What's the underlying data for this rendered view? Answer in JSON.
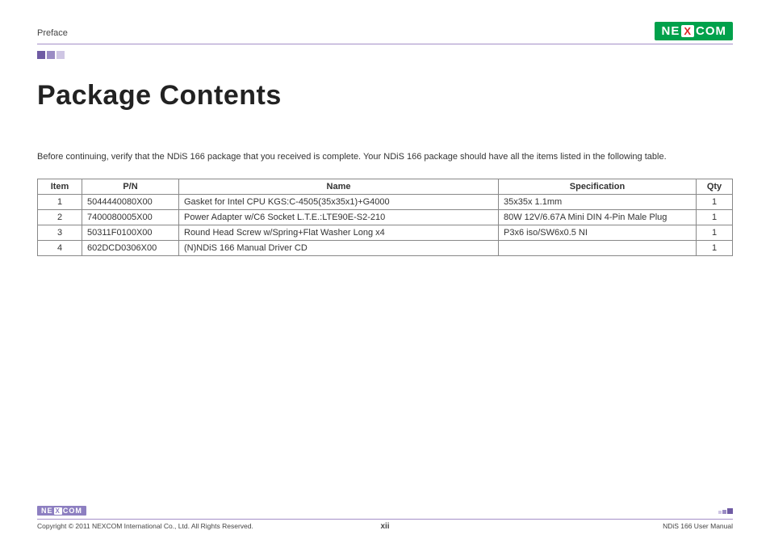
{
  "header": {
    "section": "Preface",
    "logo_left": "NE",
    "logo_x": "X",
    "logo_right": "COM"
  },
  "title": "Package Contents",
  "intro": "Before continuing, verify that the NDiS 166 package that you received is complete. Your NDiS 166 package should have all the items listed in the following table.",
  "table": {
    "headers": {
      "item": "Item",
      "pn": "P/N",
      "name": "Name",
      "spec": "Specification",
      "qty": "Qty"
    },
    "rows": [
      {
        "item": "1",
        "pn": "5044440080X00",
        "name": "Gasket for Intel CPU KGS:C-4505(35x35x1)+G4000",
        "spec": "35x35x 1.1mm",
        "qty": "1"
      },
      {
        "item": "2",
        "pn": "7400080005X00",
        "name": "Power Adapter w/C6 Socket L.T.E.:LTE90E-S2-210",
        "spec": "80W 12V/6.67A Mini DIN 4-Pin Male Plug",
        "qty": "1"
      },
      {
        "item": "3",
        "pn": "50311F0100X00",
        "name": "Round Head Screw w/Spring+Flat Washer Long x4",
        "spec": "P3x6 iso/SW6x0.5 NI",
        "qty": "1"
      },
      {
        "item": "4",
        "pn": "602DCD0306X00",
        "name": "(N)NDiS 166 Manual Driver CD",
        "spec": "",
        "qty": "1"
      }
    ]
  },
  "footer": {
    "copyright": "Copyright © 2011 NEXCOM International Co., Ltd. All Rights Reserved.",
    "page": "xii",
    "manual": "NDiS 166 User Manual",
    "logo_left": "NE",
    "logo_x": "X",
    "logo_right": "COM"
  }
}
